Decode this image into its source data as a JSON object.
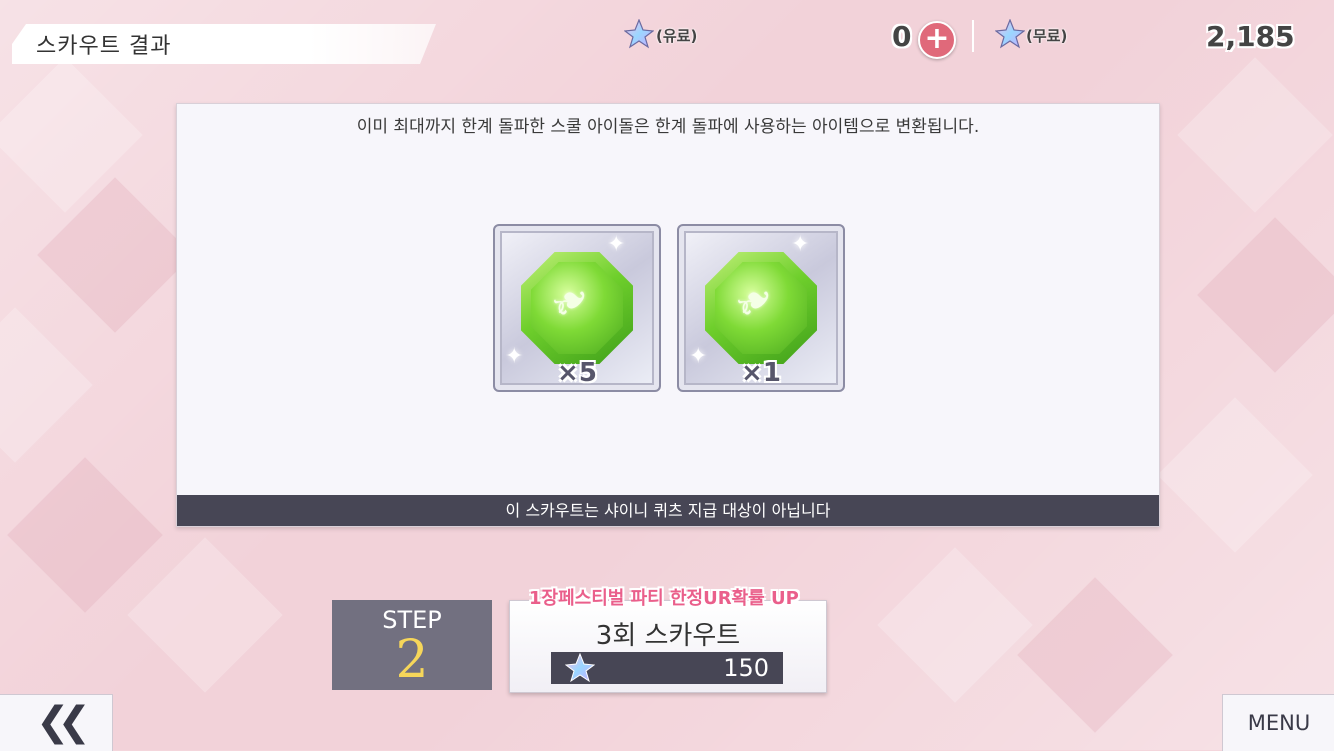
{
  "header": {
    "title": "스카우트 결과",
    "paid_label": "(유료)",
    "paid_count": "0",
    "free_label": "(무료)",
    "free_count": "2,185"
  },
  "panel": {
    "notice": "이미 최대까지 한계 돌파한 스쿨 아이돌은 한계 돌파에 사용하는 아이템으로 변환됩니다.",
    "items": [
      {
        "icon": "green-feather-gem-icon",
        "quantity": "×5"
      },
      {
        "icon": "green-feather-gem-icon",
        "quantity": "×1"
      }
    ],
    "footer": "이 스카우트는 샤이니 퀴츠 지급 대상이 아닙니다"
  },
  "step": {
    "label": "STEP",
    "number": "2"
  },
  "scout": {
    "promo": "1장페스티벌 파티 한정UR확률 UP",
    "label": "3회 스카우트",
    "cost": "150"
  },
  "nav": {
    "back_icon": "double-chevron-left-icon",
    "menu_label": "MENU"
  },
  "colors": {
    "accent_pink": "#ea5f8b",
    "dark_bar": "#474655",
    "step_gold": "#f6d65a"
  }
}
